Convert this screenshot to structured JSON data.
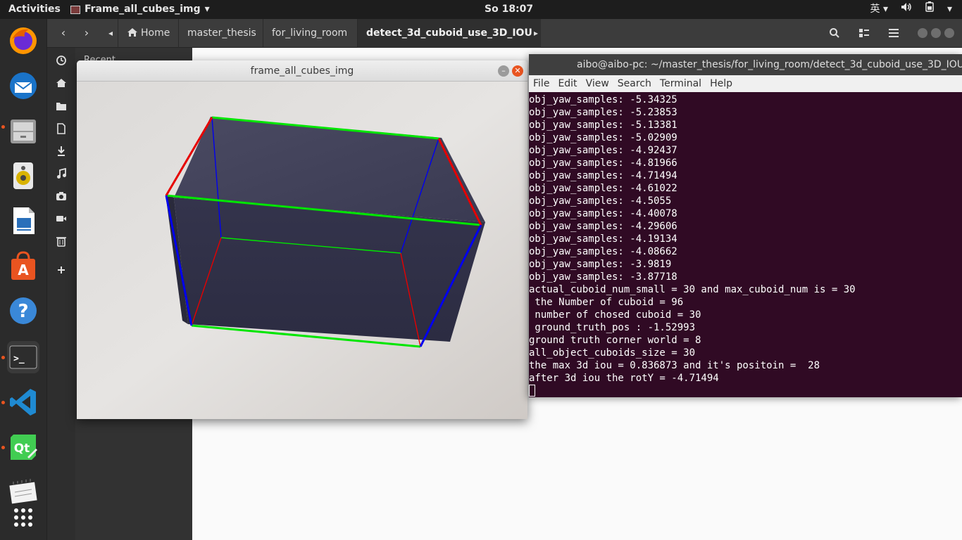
{
  "topbar": {
    "activities": "Activities",
    "app_menu": "Frame_all_cubes_img",
    "app_menu_arrow": "▾",
    "clock": "So 18:07",
    "input_method": "英",
    "input_method_arrow": "▾",
    "volume_icon": "volume-icon",
    "battery_icon": "battery-icon",
    "power_arrow": "▾"
  },
  "dock": {
    "items": [
      {
        "name": "firefox",
        "icon": "firefox-icon",
        "color": "#e66000"
      },
      {
        "name": "thunderbird",
        "icon": "thunderbird-icon",
        "color": "#1a73c8"
      },
      {
        "name": "files",
        "icon": "files-icon",
        "color": "#8a8a8a"
      },
      {
        "name": "rhythmbox",
        "icon": "speaker-icon",
        "color": "#d9c37a"
      },
      {
        "name": "libreoffice-writer",
        "icon": "writer-icon",
        "color": "#2a6fba"
      },
      {
        "name": "software",
        "icon": "software-icon",
        "color": "#e95420"
      },
      {
        "name": "help",
        "icon": "help-icon",
        "color": "#3a88d8"
      },
      {
        "name": "terminal",
        "icon": "terminal-icon",
        "color": "#2d2d2d"
      },
      {
        "name": "vscode",
        "icon": "vscode-icon",
        "color": "#1f8ad2"
      },
      {
        "name": "qtcreator",
        "icon": "qt-icon",
        "color": "#41cd52"
      },
      {
        "name": "text-editor",
        "icon": "notepad-icon",
        "color": "#777777"
      },
      {
        "name": "show-apps",
        "icon": "grid-icon",
        "color": "#2b2b2b"
      }
    ],
    "help_glyph": "?",
    "qt_glyph": "Qt",
    "software_glyph": "A",
    "terminal_glyph": ">_"
  },
  "nautilus": {
    "back": "‹",
    "forward": "›",
    "path_left": "◂",
    "path_right": "▸",
    "home_label": "Home",
    "crumbs": [
      "master_thesis",
      "for_living_room",
      "detect_3d_cuboid_use_3D_IOU"
    ],
    "recent_label": "Recent"
  },
  "image_window": {
    "title": "frame_all_cubes_img",
    "min_glyph": "–",
    "close_glyph": "✕",
    "colors": {
      "green": "#00e600",
      "red": "#e60000",
      "blue": "#0000ee"
    }
  },
  "terminal": {
    "title": "aibo@aibo-pc: ~/master_thesis/for_living_room/detect_3d_cuboid_use_3D_IOU",
    "menu": [
      "File",
      "Edit",
      "View",
      "Search",
      "Terminal",
      "Help"
    ],
    "lines": [
      "obj_yaw_samples: -5.34325",
      "obj_yaw_samples: -5.23853",
      "obj_yaw_samples: -5.13381",
      "obj_yaw_samples: -5.02909",
      "obj_yaw_samples: -4.92437",
      "obj_yaw_samples: -4.81966",
      "obj_yaw_samples: -4.71494",
      "obj_yaw_samples: -4.61022",
      "obj_yaw_samples: -4.5055",
      "obj_yaw_samples: -4.40078",
      "obj_yaw_samples: -4.29606",
      "obj_yaw_samples: -4.19134",
      "obj_yaw_samples: -4.08662",
      "obj_yaw_samples: -3.9819",
      "obj_yaw_samples: -3.87718",
      "actual_cuboid_num_small = 30 and max_cuboid_num is = 30",
      " the Number of cuboid = 96",
      " number of chosed cuboid = 30",
      " ground_truth_pos : -1.52993",
      "ground truth corner world = 8",
      "all_object_cuboids_size = 30",
      "the max 3d iou = 0.836873 and it's positoin =  28",
      "after 3d iou the rotY = -4.71494"
    ],
    "background": "#300a24"
  }
}
